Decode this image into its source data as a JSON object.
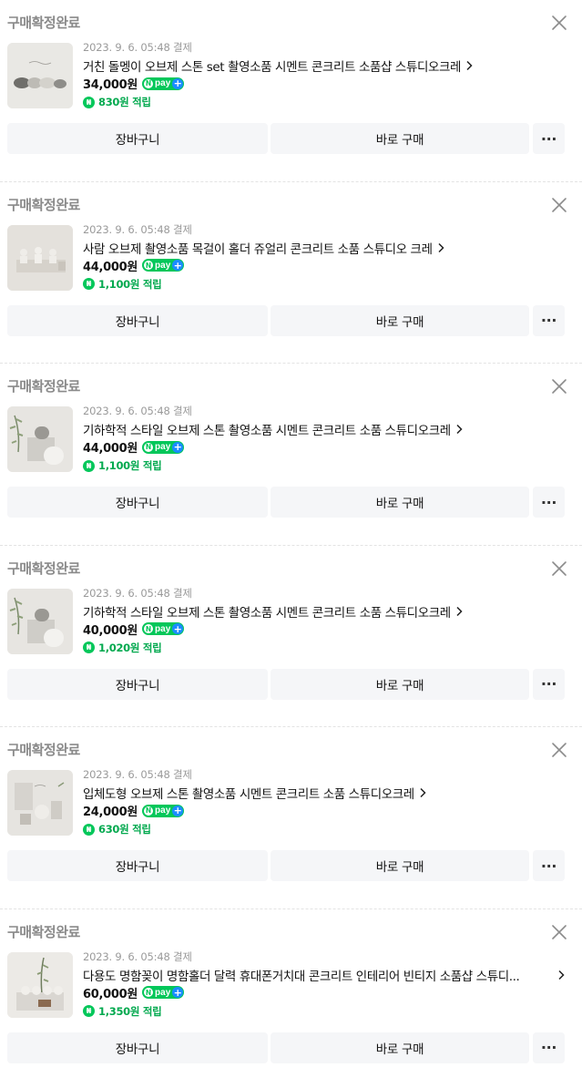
{
  "orders": [
    {
      "status": "구매확정완료",
      "date": "2023. 9. 6. 05:48 결제",
      "title": "거친 돌멩이 오브제 스톤 set 촬영소품 시멘트 콘크리트 소품샵 스튜디오크레",
      "price": "34,000원",
      "points": "830원 적립",
      "thumb_icon": "product-thumbnail-stones",
      "truncated": false
    },
    {
      "status": "구매확정완료",
      "date": "2023. 9. 6. 05:48 결제",
      "title": "사람 오브제 촬영소품 목걸이 홀더 쥬얼리 콘크리트 소품 스튜디오 크레",
      "price": "44,000원",
      "points": "1,100원 적립",
      "thumb_icon": "product-thumbnail-figures",
      "truncated": false
    },
    {
      "status": "구매확정완료",
      "date": "2023. 9. 6. 05:48 결제",
      "title": "기하학적 스타일 오브제 스톤 촬영소품 시멘트 콘크리트 소품 스튜디오크레",
      "price": "44,000원",
      "points": "1,100원 적립",
      "thumb_icon": "product-thumbnail-geometric",
      "truncated": false
    },
    {
      "status": "구매확정완료",
      "date": "2023. 9. 6. 05:48 결제",
      "title": "기하학적 스타일 오브제 스톤 촬영소품 시멘트 콘크리트 소품 스튜디오크레",
      "price": "40,000원",
      "points": "1,020원 적립",
      "thumb_icon": "product-thumbnail-geometric",
      "truncated": false
    },
    {
      "status": "구매확정완료",
      "date": "2023. 9. 6. 05:48 결제",
      "title": "입체도형 오브제 스톤 촬영소품 시멘트 콘크리트 소품 스튜디오크레",
      "price": "24,000원",
      "points": "630원 적립",
      "thumb_icon": "product-thumbnail-shapes",
      "truncated": false
    },
    {
      "status": "구매확정완료",
      "date": "2023. 9. 6. 05:48 결제",
      "title": "다용도 명함꽂이 명함홀더 달력 휴대폰거치대 콘크리트 인테리어 빈티지 소품샵 스튜디...",
      "price": "60,000원",
      "points": "1,350원 적립",
      "thumb_icon": "product-thumbnail-holder",
      "truncated": true
    }
  ],
  "buttons": {
    "cart": "장바구니",
    "buy": "바로 구매",
    "more": "···"
  },
  "npay": {
    "n": "N",
    "text": "pay",
    "plus": "+"
  },
  "points_icon": "₦",
  "colors": {
    "naver_green": "#03c75a",
    "points_text": "#03a94f",
    "npay_plus": "#1a8cff",
    "status_gray": "#8a8a8a",
    "button_bg": "#f5f6f8"
  }
}
